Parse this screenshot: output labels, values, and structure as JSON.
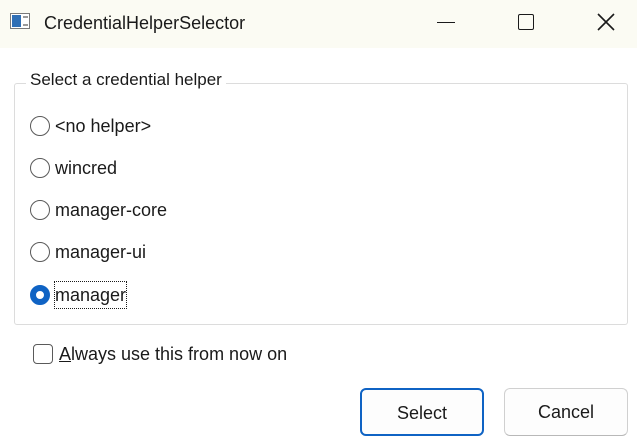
{
  "window": {
    "title": "CredentialHelperSelector"
  },
  "group": {
    "title": "Select a credential helper",
    "options": [
      {
        "label": "<no helper>",
        "checked": false
      },
      {
        "label": "wincred",
        "checked": false
      },
      {
        "label": "manager-core",
        "checked": false
      },
      {
        "label": "manager-ui",
        "checked": false
      },
      {
        "label": "manager",
        "checked": true
      }
    ]
  },
  "always_checkbox": {
    "mnemonic": "A",
    "label_rest": "lways use this from now on",
    "checked": false
  },
  "buttons": {
    "select_label": "Select",
    "cancel_label": "Cancel"
  },
  "colors": {
    "accent": "#0f63c4",
    "titlebar": "#fbfbf3"
  },
  "icons": {
    "app": "app-window-icon",
    "minimize": "minimize-icon",
    "maximize": "maximize-icon",
    "close": "close-icon"
  }
}
